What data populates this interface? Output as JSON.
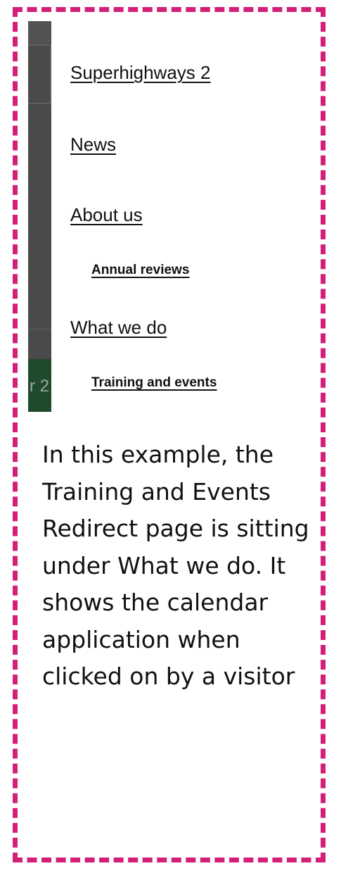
{
  "nav": {
    "items": [
      {
        "label": "Superhighways 2",
        "level": 1
      },
      {
        "label": "News",
        "level": 1
      },
      {
        "label": "About us",
        "level": 1
      },
      {
        "label": "Annual reviews",
        "level": 2
      },
      {
        "label": "What we do",
        "level": 1
      },
      {
        "label": "Training and events",
        "level": 2
      }
    ]
  },
  "background_partial_text": "r 2",
  "caption": "In this example, the Training and Events Redirect page is sitting under What we do. It shows the calendar application when clicked on by a visitor",
  "colors": {
    "border": "#d31f78",
    "overlay_gray": "#4a4a4a",
    "green": "#1f4a2c",
    "text": "#111111"
  }
}
